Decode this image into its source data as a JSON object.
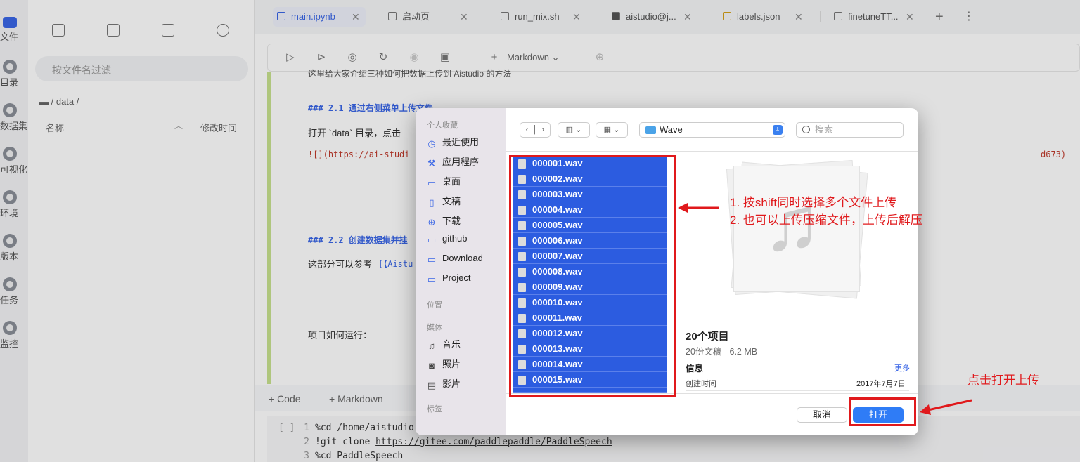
{
  "rail": {
    "items": [
      {
        "label": "文件",
        "icon": "folder-icon"
      },
      {
        "label": "目录",
        "icon": "list-icon"
      },
      {
        "label": "数据集",
        "icon": "dataset-icon"
      },
      {
        "label": "可视化",
        "icon": "chart-icon"
      },
      {
        "label": "环境",
        "icon": "environment-icon"
      },
      {
        "label": "版本",
        "icon": "version-icon"
      },
      {
        "label": "任务",
        "icon": "task-icon"
      },
      {
        "label": "监控",
        "icon": "monitor-icon"
      }
    ]
  },
  "filepanel": {
    "filter_placeholder": "按文件名过滤",
    "breadcrumb": "/ data /",
    "col_name": "名称",
    "col_time": "修改时间"
  },
  "tabs": [
    {
      "label": "main.ipynb"
    },
    {
      "label": "启动页"
    },
    {
      "label": "run_mix.sh"
    },
    {
      "label": "aistudio@j..."
    },
    {
      "label": "labels.json"
    },
    {
      "label": "finetuneTT..."
    }
  ],
  "toolbar": {
    "cell_type": "Markdown"
  },
  "notebook": {
    "line_top": "这里给大家介绍三种如何把数据上传到 Aistudio 的方法",
    "h21": "### 2.1 通过右侧菜单上传文件",
    "p21": "打开 `data` 目录，点击",
    "link1": "![](https://ai-studi",
    "link1_end": "d673)",
    "h22": "### 2.2 创建数据集并挂",
    "p22": "这部分可以参考",
    "link2": "[【Aistu",
    "run": "项目如何运行："
  },
  "addbar": {
    "code": "+ Code",
    "markdown": "+ Markdown"
  },
  "code": {
    "prompt": "[ ]",
    "lines": [
      {
        "n": "1",
        "text": "%cd /home/aistudio"
      },
      {
        "n": "2",
        "pre": "!git clone ",
        "url": "https://gitee.com/paddlepaddle/PaddleSpeech"
      },
      {
        "n": "3",
        "text": "%cd PaddleSpeech"
      }
    ]
  },
  "dialog": {
    "sidebar": {
      "favorites": "个人收藏",
      "fav_items": [
        "最近使用",
        "应用程序",
        "桌面",
        "文稿",
        "下载",
        "github",
        "Download",
        "Project"
      ],
      "locations": "位置",
      "media": "媒体",
      "media_items": [
        "音乐",
        "照片",
        "影片"
      ],
      "tags": "标签"
    },
    "location": "Wave",
    "search_placeholder": "搜索",
    "files": [
      "000001.wav",
      "000002.wav",
      "000003.wav",
      "000004.wav",
      "000005.wav",
      "000006.wav",
      "000007.wav",
      "000008.wav",
      "000009.wav",
      "000010.wav",
      "000011.wav",
      "000012.wav",
      "000013.wav",
      "000014.wav",
      "000015.wav"
    ],
    "info": {
      "title": "20个项目",
      "subtitle": "20份文稿 - 6.2 MB",
      "heading": "信息",
      "more": "更多",
      "created_label": "创建时间",
      "created_value": "2017年7月7日"
    },
    "cancel": "取消",
    "open": "打开"
  },
  "annotations": {
    "line1": "1. 按shift同时选择多个文件上传",
    "line2": "2. 也可以上传压缩文件，上传后解压",
    "click_open": "点击打开上传"
  },
  "colors": {
    "accent": "#3a66e6",
    "selection": "#2c5ce0",
    "annotation": "#e0191c",
    "open_button": "#2f7cf6"
  }
}
